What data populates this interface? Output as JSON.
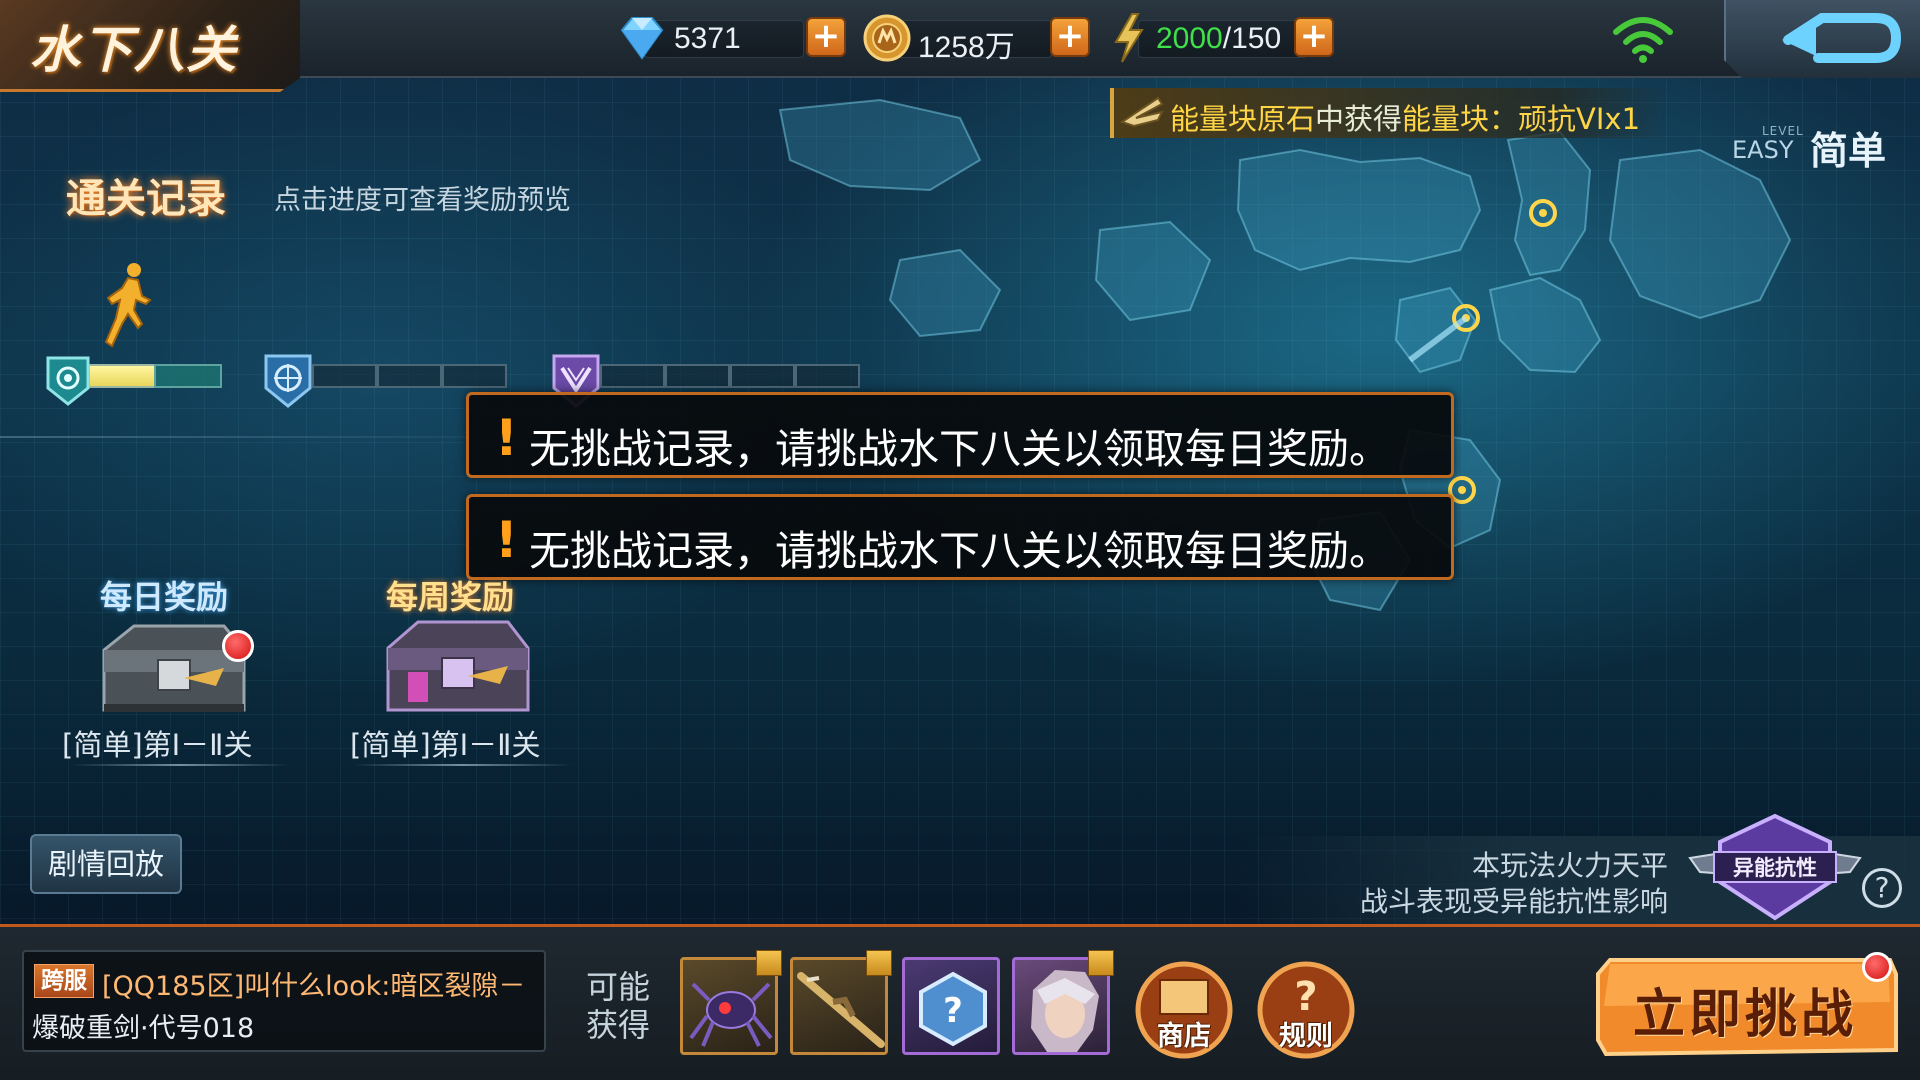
{
  "header": {
    "title": "水下八关",
    "diamonds": "5371",
    "gold": "1258万",
    "energy_current": "2000",
    "energy_max": "/150",
    "plus_label": "+"
  },
  "ticker": {
    "part1": "能量块原石",
    "part2": "中获得",
    "part3": "能量块：顽抗VIx1"
  },
  "difficulty": {
    "level_small": "LEVEL",
    "level_en": "EASY",
    "level_cn": "简单"
  },
  "record": {
    "title": "通关记录",
    "hint": "点击进度可查看奖励预览",
    "progress_fraction": 0.5
  },
  "toasts": [
    {
      "mark": "!",
      "text": "无挑战记录，请挑战水下八关以领取每日奖励。"
    },
    {
      "mark": "!",
      "text": "无挑战记录，请挑战水下八关以领取每日奖励。"
    }
  ],
  "rewards": {
    "daily_title": "每日奖励",
    "daily_range": "[简单]第Ⅰ－Ⅱ关",
    "weekly_title": "每周奖励",
    "weekly_range": "[简单]第Ⅰ－Ⅱ关"
  },
  "replay_label": "剧情回放",
  "fair_note": {
    "line1": "本玩法火力天平",
    "line2": "战斗表现受异能抗性影响",
    "badge_label": "异能抗性",
    "help": "?"
  },
  "chat": {
    "tag": "跨服",
    "line1": "[QQ185区]叫什么look:暗区裂隙－",
    "line2": "爆破重剑·代号018"
  },
  "may_get": "可能获得",
  "buttons": {
    "shop": "商店",
    "rules": "规则",
    "start": "立即挑战"
  },
  "colors": {
    "accent_orange": "#c2591c",
    "energy_green": "#3fe04a",
    "ticker_highlight": "#ffd445",
    "toast_border": "#c0691f"
  }
}
